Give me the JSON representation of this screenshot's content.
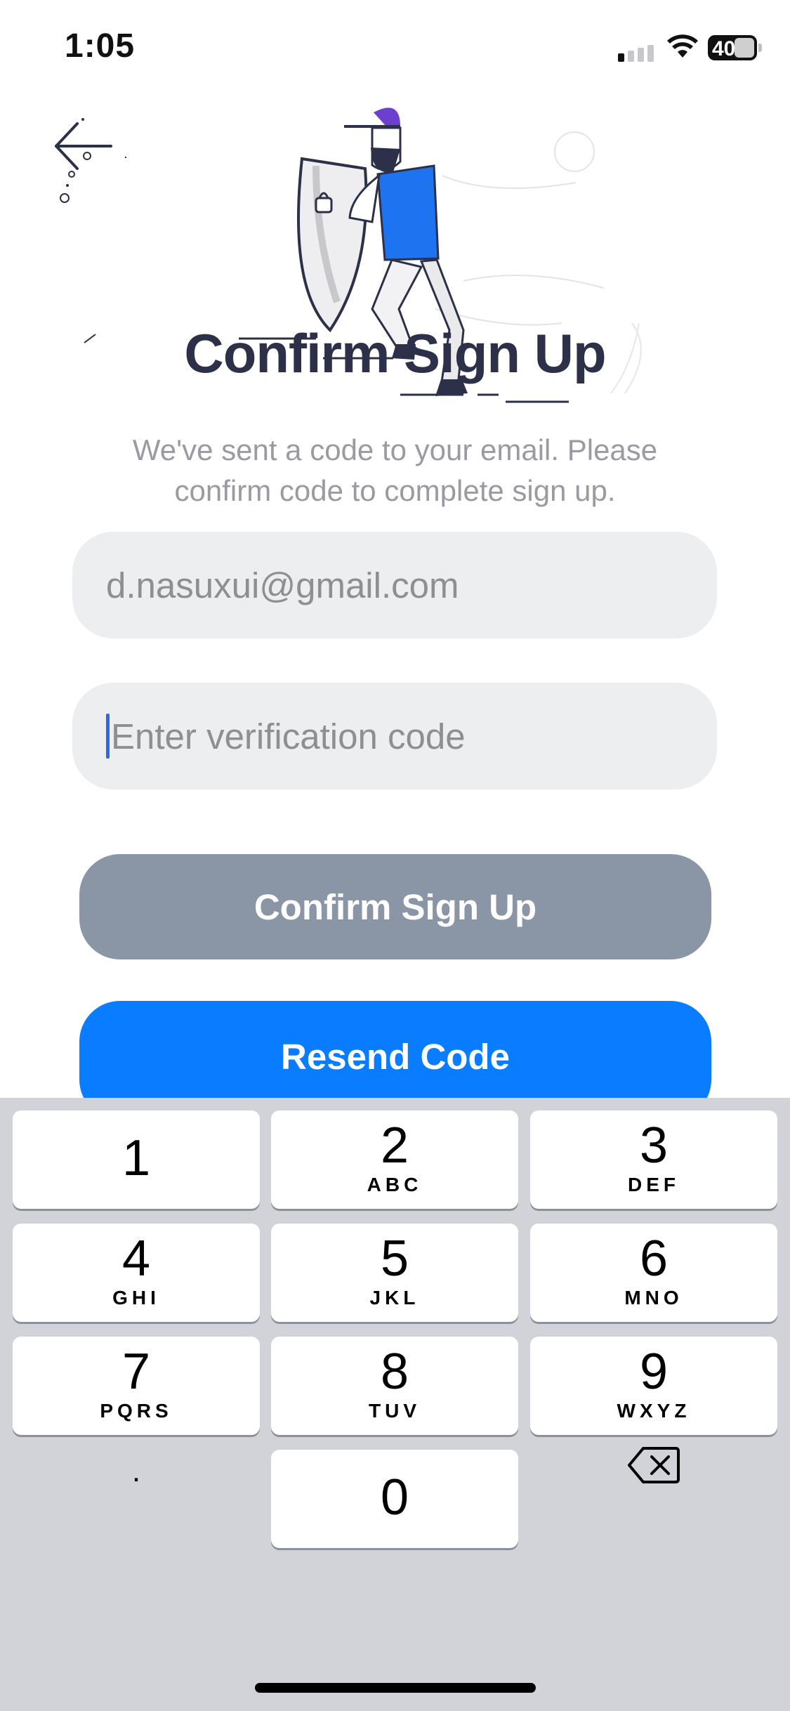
{
  "status_bar": {
    "time": "1:05",
    "battery": "40"
  },
  "header": {
    "title": "Confirm Sign Up",
    "subtitle": "We've sent a code to your email. Please confirm code to complete sign up."
  },
  "form": {
    "email_value": "d.nasuxui@gmail.com",
    "code_placeholder": "Enter verification code"
  },
  "buttons": {
    "confirm_label": "Confirm Sign Up",
    "resend_label": "Resend Code"
  },
  "keyboard": {
    "keys": [
      {
        "num": "1",
        "letters": ""
      },
      {
        "num": "2",
        "letters": "ABC"
      },
      {
        "num": "3",
        "letters": "DEF"
      },
      {
        "num": "4",
        "letters": "GHI"
      },
      {
        "num": "5",
        "letters": "JKL"
      },
      {
        "num": "6",
        "letters": "MNO"
      },
      {
        "num": "7",
        "letters": "PQRS"
      },
      {
        "num": "8",
        "letters": "TUV"
      },
      {
        "num": "9",
        "letters": "WXYZ"
      },
      {
        "num": "0",
        "letters": ""
      }
    ],
    "dot_label": ".",
    "delete_icon": "backspace-icon"
  },
  "colors": {
    "title": "#2c3048",
    "confirm_button": "#8a95a5",
    "resend_button": "#0a7cff",
    "field_background": "#edeef0",
    "keyboard_background": "#d1d3d9"
  }
}
